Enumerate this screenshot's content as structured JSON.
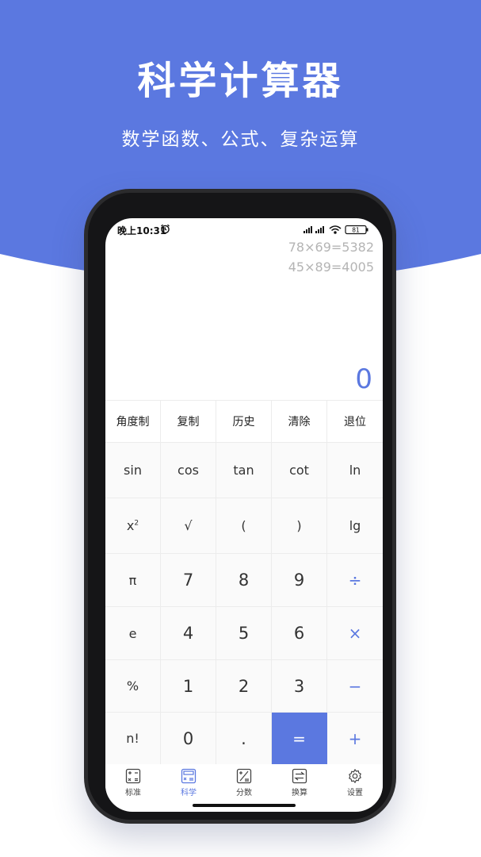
{
  "promo": {
    "title": "科学计算器",
    "subtitle": "数学函数、公式、复杂运算",
    "accent_color": "#5b78e0"
  },
  "status_bar": {
    "time": "晚上10:31",
    "battery": "81",
    "icons": [
      "alarm-icon",
      "signal-icon",
      "signal-icon",
      "wifi-icon",
      "battery-icon"
    ]
  },
  "display": {
    "history": [
      "78×69=5382",
      "45×89=4005"
    ],
    "value": "0"
  },
  "keypad": {
    "function_row": [
      "角度制",
      "复制",
      "历史",
      "清除",
      "退位"
    ],
    "rows": [
      [
        "sin",
        "cos",
        "tan",
        "cot",
        "ln"
      ],
      [
        "x2",
        "√",
        "(",
        ")",
        "lg"
      ],
      [
        "π",
        "7",
        "8",
        "9",
        "÷"
      ],
      [
        "e",
        "4",
        "5",
        "6",
        "×"
      ],
      [
        "%",
        "1",
        "2",
        "3",
        "−"
      ],
      [
        "n!",
        "0",
        ".",
        "=",
        "+"
      ]
    ]
  },
  "tabbar": {
    "items": [
      {
        "label": "标准",
        "icon": "standard-calc-icon"
      },
      {
        "label": "科学",
        "icon": "scientific-calc-icon"
      },
      {
        "label": "分数",
        "icon": "fraction-icon"
      },
      {
        "label": "换算",
        "icon": "convert-icon"
      },
      {
        "label": "设置",
        "icon": "settings-icon"
      }
    ],
    "active": "科学"
  }
}
